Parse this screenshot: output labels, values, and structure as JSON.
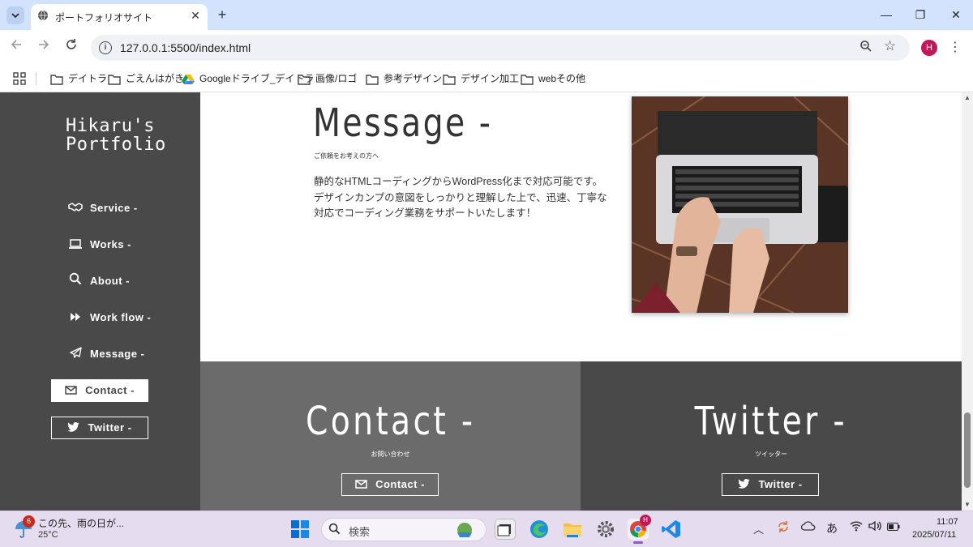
{
  "browser": {
    "tab_title": "ポートフォリオサイト",
    "tab_close": "✕",
    "new_tab": "+",
    "url": "127.0.0.1:5500/index.html",
    "profile_initial": "H",
    "window_controls": {
      "minimize": "—",
      "maximize": "❐",
      "close": "✕"
    }
  },
  "bookmarks": [
    {
      "label": "デイトラ",
      "icon": "folder-icon"
    },
    {
      "label": "ごえんはがき",
      "icon": "folder-icon"
    },
    {
      "label": "Googleドライブ_デイトラ",
      "icon": "google-drive-icon"
    },
    {
      "label": "画像/ロゴ",
      "icon": "folder-icon"
    },
    {
      "label": "参考デザイン",
      "icon": "folder-icon"
    },
    {
      "label": "デザイン加工",
      "icon": "folder-icon"
    },
    {
      "label": "webその他",
      "icon": "folder-icon"
    }
  ],
  "sidebar": {
    "logo_line1": "Hikaru's",
    "logo_line2": "Portfolio",
    "nav": [
      {
        "label": "Service -",
        "icon": "handshake-icon"
      },
      {
        "label": "Works -",
        "icon": "laptop-icon"
      },
      {
        "label": "About -",
        "icon": "search-icon"
      },
      {
        "label": "Work flow -",
        "icon": "fast-forward-icon"
      },
      {
        "label": "Message -",
        "icon": "paper-plane-icon"
      }
    ],
    "contact_button": "Contact -",
    "twitter_button": "Twitter -"
  },
  "message": {
    "title": "Message -",
    "subtitle": "ご依頼をお考えの方へ",
    "body_line1": "静的なHTMLコーディングからWordPress化まで対応可能です。",
    "body_line2": "デザインカンプの意図をしっかりと理解した上で、迅速、丁寧な対応でコーディング業務をサポートいたします！"
  },
  "contact": {
    "title": "Contact -",
    "subtitle": "お問い合わせ",
    "button": "Contact -"
  },
  "twitter": {
    "title": "Twitter -",
    "subtitle": "ツイッター",
    "button": "Twitter -"
  },
  "taskbar": {
    "weather_badge": "6",
    "weather_text": "この先、雨の日が...",
    "weather_temp": "25°C",
    "search_placeholder": "検索",
    "ime": "あ",
    "time": "11:07",
    "date": "2025/07/11"
  },
  "colors": {
    "sidebar_bg": "#494949",
    "contact_bg": "#6b6b6b",
    "twitter_bg": "#494949",
    "tab_bar_bg": "#d3e3fd",
    "taskbar_bg": "#e6dcef",
    "profile_accent": "#c2185b"
  }
}
